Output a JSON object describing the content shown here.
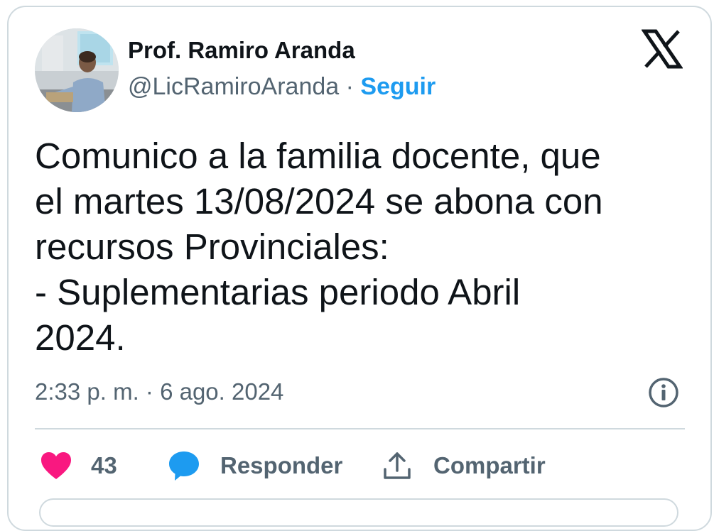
{
  "author": {
    "name": "Prof. Ramiro Aranda",
    "handle": "@LicRamiroAranda",
    "separator": "·",
    "follow_label": "Seguir"
  },
  "tweet": {
    "lines": [
      "Comunico a la familia docente, que",
      "el martes 13/08/2024 se abona con",
      "recursos Provinciales:",
      "- Suplementarias periodo Abril",
      "2024."
    ],
    "timestamp": "2:33 p. m. · 6 ago. 2024"
  },
  "actions": {
    "likes_count": "43",
    "reply_label": "Responder",
    "share_label": "Compartir"
  },
  "icons": {
    "platform_logo": "x-logo-icon",
    "info": "info-icon",
    "like": "heart-icon",
    "reply": "speech-bubble-icon",
    "share": "share-upload-icon"
  },
  "colors": {
    "accent": "#1d9bf0",
    "heart": "#f91880",
    "text_primary": "#0f1419",
    "text_secondary": "#536471",
    "border": "#cfd9de"
  }
}
